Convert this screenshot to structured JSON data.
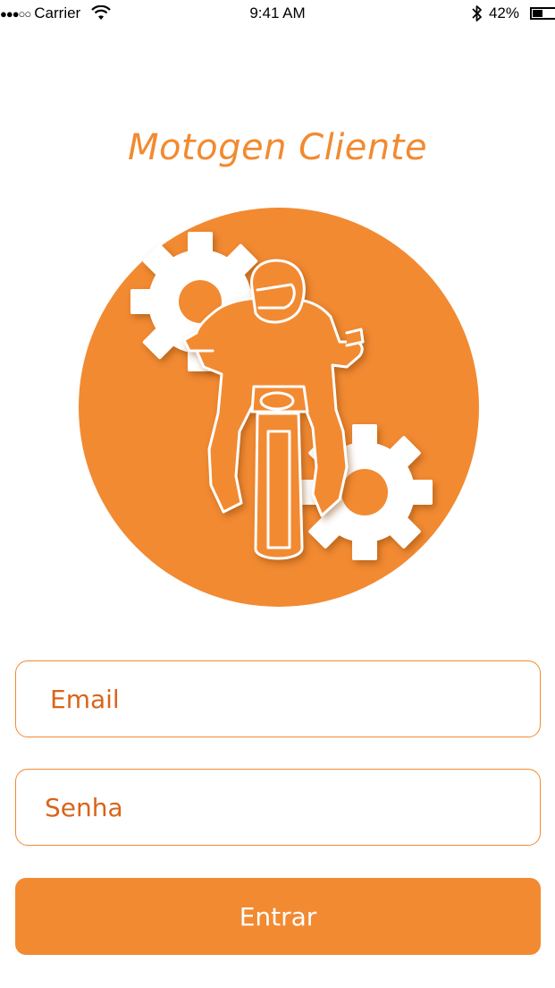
{
  "status_bar": {
    "signal_dots": "●●●○○",
    "carrier": "Carrier",
    "wifi_icon": "wifi-icon",
    "time": "9:41 AM",
    "bluetooth_icon": "bluetooth-icon",
    "battery_percent": "42%",
    "battery_level": 0.42
  },
  "app": {
    "title": "Motogen Cliente",
    "logo_icon": "motorcycle-rider-gears-icon",
    "accent_color": "#f28a30"
  },
  "form": {
    "email": {
      "value": "",
      "placeholder": "Email"
    },
    "password": {
      "value": "",
      "placeholder": "Senha"
    },
    "submit_label": "Entrar"
  }
}
